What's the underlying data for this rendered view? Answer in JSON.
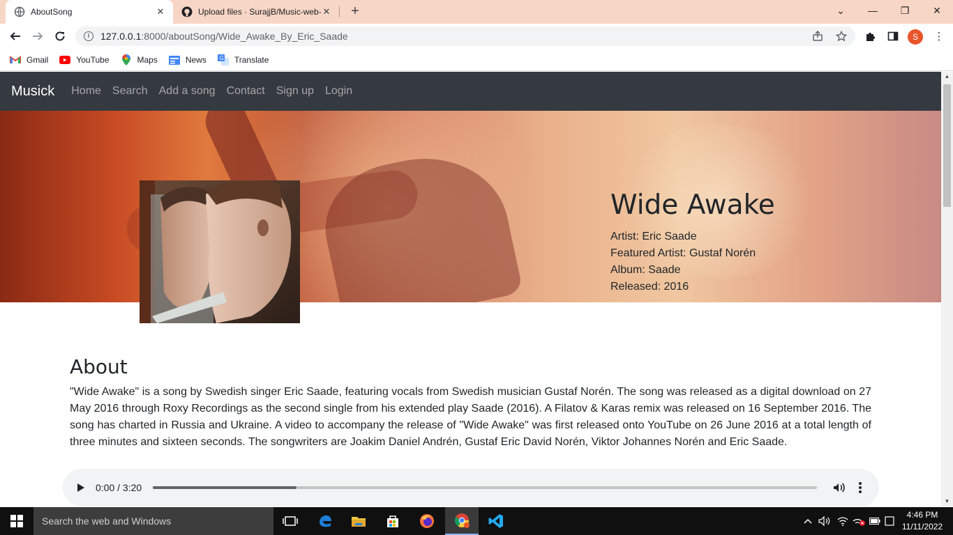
{
  "browser": {
    "tabs": [
      {
        "title": "AboutSong",
        "active": true
      },
      {
        "title": "Upload files · SurajjB/Music-web-",
        "active": false
      }
    ],
    "url_host": "127.0.0.1",
    "url_rest": ":8000/aboutSong/Wide_Awake_By_Eric_Saade",
    "profile_initial": "S",
    "bookmarks": [
      {
        "label": "Gmail",
        "icon": "gmail-icon"
      },
      {
        "label": "YouTube",
        "icon": "youtube-icon"
      },
      {
        "label": "Maps",
        "icon": "maps-icon"
      },
      {
        "label": "News",
        "icon": "news-icon"
      },
      {
        "label": "Translate",
        "icon": "translate-icon"
      }
    ]
  },
  "site": {
    "brand": "Musick",
    "nav": [
      "Home",
      "Search",
      "Add a song",
      "Contact",
      "Sign up",
      "Login"
    ],
    "colors": {
      "navbar": "#343a40",
      "text": "#212529"
    }
  },
  "song": {
    "title": "Wide Awake",
    "artist": "Artist: Eric Saade",
    "featured": "Featured Artist: Gustaf Norén",
    "album": "Album: Saade",
    "released": "Released: 2016"
  },
  "about": {
    "heading": "About",
    "text": "\"Wide Awake\" is a song by Swedish singer Eric Saade, featuring vocals from Swedish musician Gustaf Norén. The song was released as a digital download on 27 May 2016 through Roxy Recordings as the second single from his extended play Saade (2016). A Filatov & Karas remix was released on 16 September 2016. The song has charted in Russia and Ukraine. A video to accompany the release of \"Wide Awake\" was first released onto YouTube on 26 June 2016 at a total length of three minutes and sixteen seconds. The songwriters are Joakim Daniel Andrén, Gustaf Eric David Norén, Viktor Johannes Norén and Eric Saade."
  },
  "player": {
    "time": "0:00 / 3:20",
    "buffered_fraction": 0.216
  },
  "taskbar": {
    "search_placeholder": "Search the web and Windows",
    "time": "4:46 PM",
    "date": "11/11/2022"
  }
}
